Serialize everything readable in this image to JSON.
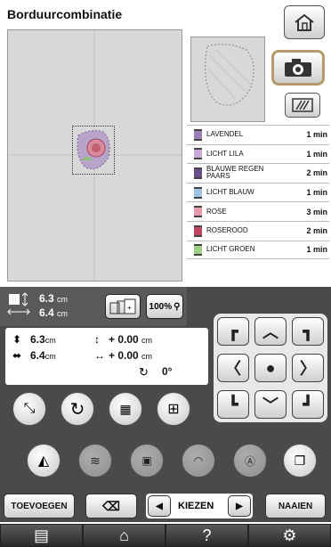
{
  "header": {
    "title": "Borduurcombinatie"
  },
  "colors": [
    {
      "name": "LAVENDEL",
      "time": "1 min",
      "color": "#9a7fb8"
    },
    {
      "name": "LICHT LILA",
      "time": "1 min",
      "color": "#c9a9d6"
    },
    {
      "name": "BLAUWE REGEN PAARS",
      "time": "2 min",
      "color": "#6a4f8a"
    },
    {
      "name": "LICHT BLAUW",
      "time": "1 min",
      "color": "#9fc3e0"
    },
    {
      "name": "ROSE",
      "time": "3 min",
      "color": "#e89aa8"
    },
    {
      "name": "ROSEROOD",
      "time": "2 min",
      "color": "#c04560"
    },
    {
      "name": "LICHT GROEN",
      "time": "1 min",
      "color": "#9fd08a"
    }
  ],
  "size": {
    "height": "6.3",
    "width": "6.4",
    "unit": "cm"
  },
  "zoom": "100%",
  "position": {
    "height": "6.3",
    "width": "6.4",
    "unit": "cm",
    "offset_y": "+ 0.00",
    "offset_x": "+ 0.00",
    "offset_unit": "cm",
    "angle": "0°"
  },
  "buttons": {
    "add": "TOEVOEGEN",
    "select": "KIEZEN",
    "sew": "NAAIEN"
  },
  "footer": {
    "help": "?"
  }
}
